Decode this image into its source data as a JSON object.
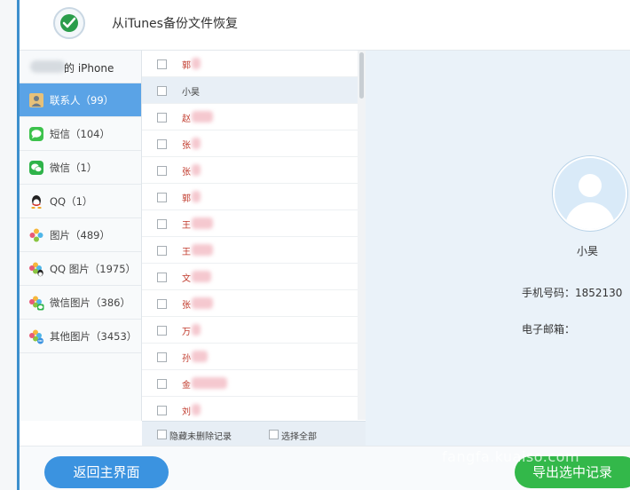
{
  "header": {
    "title": "从iTunes备份文件恢复"
  },
  "sidebar": {
    "device": "的 iPhone",
    "items": [
      {
        "label": "联系人（99）",
        "icon": "contact-icon",
        "active": true
      },
      {
        "label": "短信（104）",
        "icon": "sms-icon",
        "active": false
      },
      {
        "label": "微信（1）",
        "icon": "wechat-icon",
        "active": false
      },
      {
        "label": "QQ（1）",
        "icon": "qq-icon",
        "active": false
      },
      {
        "label": "图片（489）",
        "icon": "photos-icon",
        "active": false
      },
      {
        "label": "QQ 图片（1975）",
        "icon": "qq-photos-icon",
        "active": false
      },
      {
        "label": "微信图片（386）",
        "icon": "wechat-photos-icon",
        "active": false
      },
      {
        "label": "其他图片（3453）",
        "icon": "other-photos-icon",
        "active": false
      }
    ]
  },
  "contacts": {
    "rows": [
      {
        "name": "郭"
      },
      {
        "name": "小昊"
      },
      {
        "name": "赵"
      },
      {
        "name": "张"
      },
      {
        "name": "张"
      },
      {
        "name": "郭"
      },
      {
        "name": "王"
      },
      {
        "name": "王"
      },
      {
        "name": "文"
      },
      {
        "name": "张"
      },
      {
        "name": "万"
      },
      {
        "name": "孙"
      },
      {
        "name": "金"
      },
      {
        "name": "刘"
      }
    ],
    "footer": {
      "hide_undeleted": "隐藏未删除记录",
      "select_all": "选择全部"
    }
  },
  "detail": {
    "name": "小昊",
    "phone_label": "手机号码：1852130",
    "email_label": "电子邮箱："
  },
  "buttons": {
    "back": "返回主界面",
    "export": "导出选中记录"
  },
  "watermark": "fangfa.kuaiso.com",
  "colors": {
    "accent": "#3b93e0",
    "active_nav": "#5aa3e6",
    "export": "#33b84a"
  }
}
